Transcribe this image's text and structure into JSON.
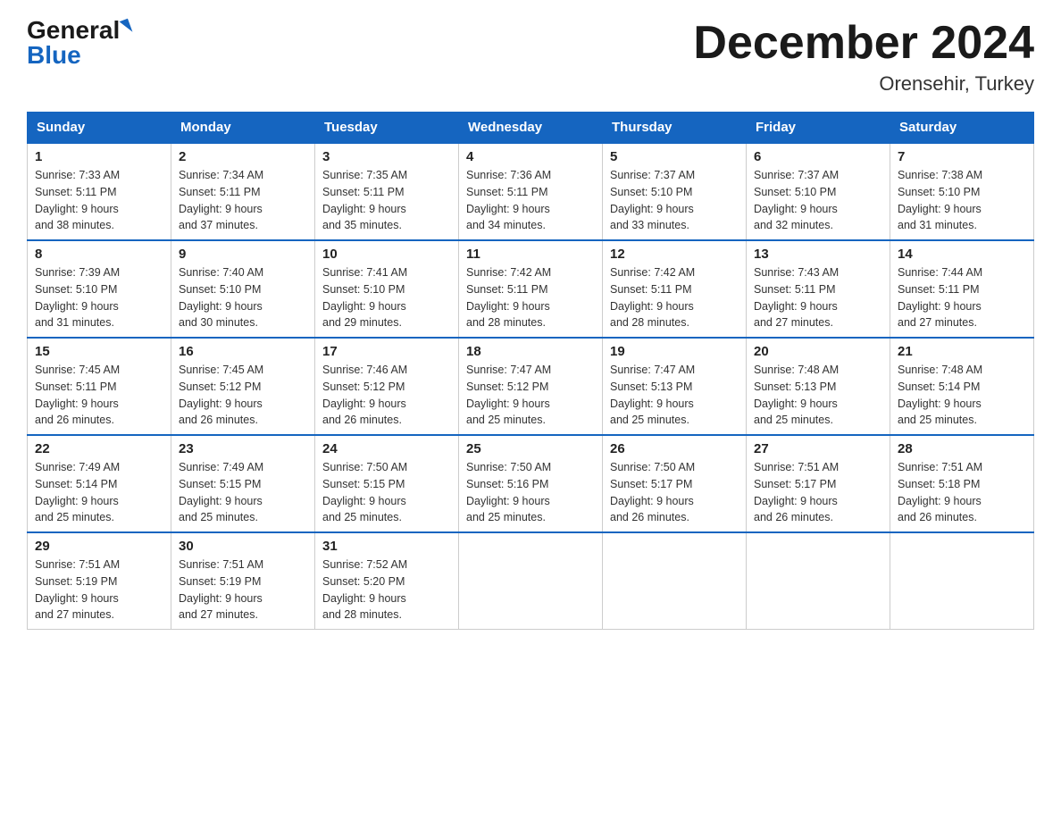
{
  "logo": {
    "general": "General",
    "blue": "Blue",
    "triangle": "▲"
  },
  "title": "December 2024",
  "subtitle": "Orensehir, Turkey",
  "days_of_week": [
    "Sunday",
    "Monday",
    "Tuesday",
    "Wednesday",
    "Thursday",
    "Friday",
    "Saturday"
  ],
  "weeks": [
    [
      {
        "num": "1",
        "sunrise": "7:33 AM",
        "sunset": "5:11 PM",
        "daylight": "9 hours and 38 minutes."
      },
      {
        "num": "2",
        "sunrise": "7:34 AM",
        "sunset": "5:11 PM",
        "daylight": "9 hours and 37 minutes."
      },
      {
        "num": "3",
        "sunrise": "7:35 AM",
        "sunset": "5:11 PM",
        "daylight": "9 hours and 35 minutes."
      },
      {
        "num": "4",
        "sunrise": "7:36 AM",
        "sunset": "5:11 PM",
        "daylight": "9 hours and 34 minutes."
      },
      {
        "num": "5",
        "sunrise": "7:37 AM",
        "sunset": "5:10 PM",
        "daylight": "9 hours and 33 minutes."
      },
      {
        "num": "6",
        "sunrise": "7:37 AM",
        "sunset": "5:10 PM",
        "daylight": "9 hours and 32 minutes."
      },
      {
        "num": "7",
        "sunrise": "7:38 AM",
        "sunset": "5:10 PM",
        "daylight": "9 hours and 31 minutes."
      }
    ],
    [
      {
        "num": "8",
        "sunrise": "7:39 AM",
        "sunset": "5:10 PM",
        "daylight": "9 hours and 31 minutes."
      },
      {
        "num": "9",
        "sunrise": "7:40 AM",
        "sunset": "5:10 PM",
        "daylight": "9 hours and 30 minutes."
      },
      {
        "num": "10",
        "sunrise": "7:41 AM",
        "sunset": "5:10 PM",
        "daylight": "9 hours and 29 minutes."
      },
      {
        "num": "11",
        "sunrise": "7:42 AM",
        "sunset": "5:11 PM",
        "daylight": "9 hours and 28 minutes."
      },
      {
        "num": "12",
        "sunrise": "7:42 AM",
        "sunset": "5:11 PM",
        "daylight": "9 hours and 28 minutes."
      },
      {
        "num": "13",
        "sunrise": "7:43 AM",
        "sunset": "5:11 PM",
        "daylight": "9 hours and 27 minutes."
      },
      {
        "num": "14",
        "sunrise": "7:44 AM",
        "sunset": "5:11 PM",
        "daylight": "9 hours and 27 minutes."
      }
    ],
    [
      {
        "num": "15",
        "sunrise": "7:45 AM",
        "sunset": "5:11 PM",
        "daylight": "9 hours and 26 minutes."
      },
      {
        "num": "16",
        "sunrise": "7:45 AM",
        "sunset": "5:12 PM",
        "daylight": "9 hours and 26 minutes."
      },
      {
        "num": "17",
        "sunrise": "7:46 AM",
        "sunset": "5:12 PM",
        "daylight": "9 hours and 26 minutes."
      },
      {
        "num": "18",
        "sunrise": "7:47 AM",
        "sunset": "5:12 PM",
        "daylight": "9 hours and 25 minutes."
      },
      {
        "num": "19",
        "sunrise": "7:47 AM",
        "sunset": "5:13 PM",
        "daylight": "9 hours and 25 minutes."
      },
      {
        "num": "20",
        "sunrise": "7:48 AM",
        "sunset": "5:13 PM",
        "daylight": "9 hours and 25 minutes."
      },
      {
        "num": "21",
        "sunrise": "7:48 AM",
        "sunset": "5:14 PM",
        "daylight": "9 hours and 25 minutes."
      }
    ],
    [
      {
        "num": "22",
        "sunrise": "7:49 AM",
        "sunset": "5:14 PM",
        "daylight": "9 hours and 25 minutes."
      },
      {
        "num": "23",
        "sunrise": "7:49 AM",
        "sunset": "5:15 PM",
        "daylight": "9 hours and 25 minutes."
      },
      {
        "num": "24",
        "sunrise": "7:50 AM",
        "sunset": "5:15 PM",
        "daylight": "9 hours and 25 minutes."
      },
      {
        "num": "25",
        "sunrise": "7:50 AM",
        "sunset": "5:16 PM",
        "daylight": "9 hours and 25 minutes."
      },
      {
        "num": "26",
        "sunrise": "7:50 AM",
        "sunset": "5:17 PM",
        "daylight": "9 hours and 26 minutes."
      },
      {
        "num": "27",
        "sunrise": "7:51 AM",
        "sunset": "5:17 PM",
        "daylight": "9 hours and 26 minutes."
      },
      {
        "num": "28",
        "sunrise": "7:51 AM",
        "sunset": "5:18 PM",
        "daylight": "9 hours and 26 minutes."
      }
    ],
    [
      {
        "num": "29",
        "sunrise": "7:51 AM",
        "sunset": "5:19 PM",
        "daylight": "9 hours and 27 minutes."
      },
      {
        "num": "30",
        "sunrise": "7:51 AM",
        "sunset": "5:19 PM",
        "daylight": "9 hours and 27 minutes."
      },
      {
        "num": "31",
        "sunrise": "7:52 AM",
        "sunset": "5:20 PM",
        "daylight": "9 hours and 28 minutes."
      },
      null,
      null,
      null,
      null
    ]
  ]
}
